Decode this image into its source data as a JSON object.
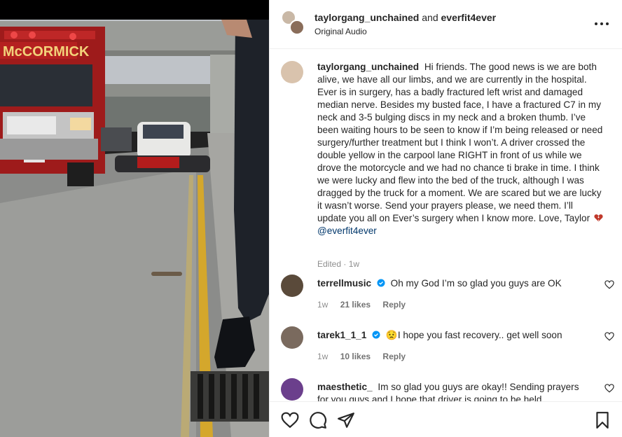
{
  "media": {
    "description_icon": "video-frame",
    "vehicle_text": "McCORMICK"
  },
  "post_header": {
    "user1": "taylorgang_unchained",
    "joiner": "and",
    "user2": "everfit4ever",
    "subtitle": "Original Audio",
    "more_icon": "more-horizontal-icon"
  },
  "caption": {
    "username": "taylorgang_unchained",
    "text": "Hi friends. The good news is we are both alive, we have all our limbs, and we are currently in the hospital. Ever is in surgery, has a badly fractured left wrist and damaged median nerve. Besides my busted face, I have a fractured C7 in my neck and 3-5 bulging discs in my neck and a broken thumb. I’ve been waiting hours to be seen to know if I’m being released or need surgery/further treatment but I think I won’t. A driver crossed the double yellow in the carpool lane RIGHT in front of us while we drove the motorcycle and we had no chance ti brake in time. I think we were lucky and flew into the bed of the truck, although I was dragged by the truck for a moment. We are scared but we are lucky it wasn’t worse. Send your prayers please, we need them. I’ll update you all on Ever’s surgery when I know more. Love, Taylor",
    "emoji_icon": "broken-heart-icon",
    "mention": "@everfit4ever",
    "meta": "Edited · 1w"
  },
  "comments": [
    {
      "username": "terrellmusic",
      "verified": true,
      "text": "Oh my God I’m so glad you guys are OK",
      "age": "1w",
      "likes": "21 likes",
      "reply": "Reply",
      "avatar_color": "#5a4a3a"
    },
    {
      "username": "tarek1_1_1",
      "verified": true,
      "emoji": "😟",
      "text": "I hope you fast recovery.. get well soon",
      "age": "1w",
      "likes": "10 likes",
      "reply": "Reply",
      "avatar_color": "#7a6a5e"
    },
    {
      "username": "maesthetic_",
      "verified": false,
      "text": "Im so glad you guys are okay!! Sending prayers for you guys and I hope that driver is going to be held",
      "avatar_color": "#6b3f8c"
    }
  ],
  "actions": {
    "like_icon": "heart-icon",
    "comment_icon": "comment-icon",
    "share_icon": "share-icon",
    "save_icon": "bookmark-icon"
  },
  "colors": {
    "mention": "#00376b",
    "verified": "#0095f6",
    "broken_heart": "#c0392b",
    "meta": "#8e8e8e"
  }
}
